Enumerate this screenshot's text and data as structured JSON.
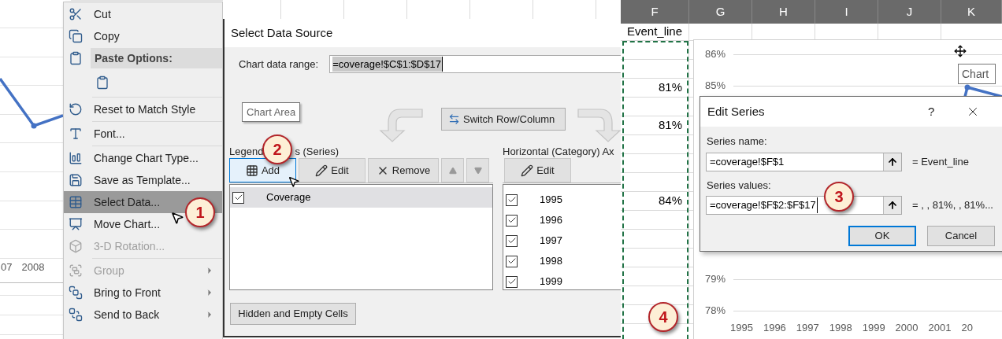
{
  "context_menu_panel": {
    "chart_axis_labels": [
      "07",
      "2008"
    ],
    "menu_items": [
      {
        "kind": "item",
        "label": "Cut",
        "disabled": false,
        "selected": false,
        "submenu": false
      },
      {
        "kind": "item",
        "label": "Copy",
        "disabled": false,
        "selected": false,
        "submenu": false
      },
      {
        "kind": "header",
        "label": "Paste Options:"
      },
      {
        "kind": "paste"
      },
      {
        "kind": "separator"
      },
      {
        "kind": "item",
        "label": "Reset to Match Style",
        "disabled": false,
        "selected": false,
        "submenu": false
      },
      {
        "kind": "separator"
      },
      {
        "kind": "item",
        "label": "Font...",
        "disabled": false,
        "selected": false,
        "submenu": false
      },
      {
        "kind": "separator"
      },
      {
        "kind": "item",
        "label": "Change Chart Type...",
        "disabled": false,
        "selected": false,
        "submenu": false
      },
      {
        "kind": "item",
        "label": "Save as Template...",
        "disabled": false,
        "selected": false,
        "submenu": false
      },
      {
        "kind": "item",
        "label": "Select Data...",
        "disabled": false,
        "selected": true,
        "submenu": false
      },
      {
        "kind": "item",
        "label": "Move Chart...",
        "disabled": false,
        "selected": false,
        "submenu": false
      },
      {
        "kind": "item",
        "label": "3-D Rotation...",
        "disabled": true,
        "selected": false,
        "submenu": false
      },
      {
        "kind": "separator"
      },
      {
        "kind": "item",
        "label": "Group",
        "disabled": true,
        "selected": false,
        "submenu": true
      },
      {
        "kind": "item",
        "label": "Bring to Front",
        "disabled": false,
        "selected": false,
        "submenu": true
      },
      {
        "kind": "item",
        "label": "Send to Back",
        "disabled": false,
        "selected": false,
        "submenu": true
      }
    ],
    "callout": "1"
  },
  "select_data_source": {
    "title": "Select Data Source",
    "range_label": "Chart data range:",
    "range_value": "=coverage!$C$1:$D$17",
    "tooltip": "Chart Area",
    "switch_button": "Switch Row/Column",
    "legend_label_parts": [
      "Legend",
      "s (Series)"
    ],
    "legend_buttons": [
      {
        "kind": "text",
        "label": "Add",
        "selected": true
      },
      {
        "kind": "text",
        "label": "Edit",
        "selected": false
      },
      {
        "kind": "text",
        "label": "Remove",
        "selected": false
      },
      {
        "kind": "up",
        "selected": false
      },
      {
        "kind": "down",
        "selected": false
      }
    ],
    "series": [
      {
        "name": "Coverage",
        "checked": true,
        "selected": true
      }
    ],
    "axis_label": "Horizontal (Category) Ax",
    "axis_edit_button": "Edit",
    "categories": [
      {
        "name": "1995",
        "checked": true
      },
      {
        "name": "1996",
        "checked": true
      },
      {
        "name": "1997",
        "checked": true
      },
      {
        "name": "1998",
        "checked": true
      },
      {
        "name": "1999",
        "checked": true
      }
    ],
    "hidden_cells_button": "Hidden and Empty Cells",
    "callout": "2"
  },
  "sheet": {
    "columns": [
      "F",
      "G",
      "H",
      "I",
      "J",
      "K"
    ],
    "f_cells": [
      {
        "kind": "header",
        "text": "Event_line"
      },
      {
        "kind": "empty"
      },
      {
        "kind": "empty"
      },
      {
        "kind": "value",
        "text": "81%"
      },
      {
        "kind": "empty"
      },
      {
        "kind": "value",
        "text": "81%"
      },
      {
        "kind": "empty"
      },
      {
        "kind": "empty"
      },
      {
        "kind": "empty"
      },
      {
        "kind": "value",
        "text": "84%"
      },
      {
        "kind": "empty"
      },
      {
        "kind": "empty"
      },
      {
        "kind": "empty"
      },
      {
        "kind": "empty"
      },
      {
        "kind": "empty"
      },
      {
        "kind": "empty"
      }
    ],
    "callout": "4"
  },
  "chart": {
    "y_labels": [
      "86%",
      "85%",
      "79%",
      "78%"
    ],
    "x_labels": [
      "1995",
      "1996",
      "1997",
      "1998",
      "1999",
      "2000",
      "2001",
      "20"
    ],
    "tooltip": "Chart"
  },
  "edit_series": {
    "title": "Edit Series",
    "help": "?",
    "name_label": "Series name:",
    "name_value": "=coverage!$F$1",
    "name_preview": "= Event_line",
    "values_label": "Series values:",
    "values_value": "=coverage!$F$2:$F$17",
    "values_preview": "= , , 81%, , 81%...",
    "ok": "OK",
    "cancel": "Cancel",
    "callout": "3"
  }
}
